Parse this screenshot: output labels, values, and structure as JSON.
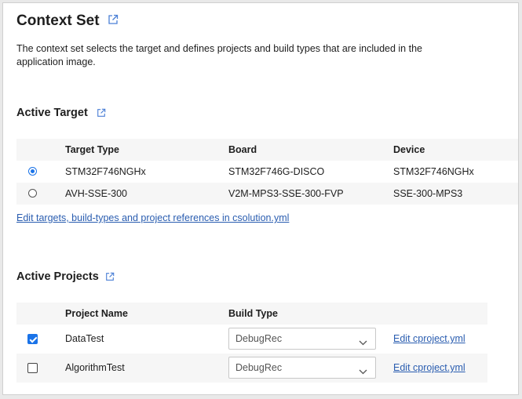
{
  "header": {
    "title": "Context Set",
    "description": "The context set selects the target and defines projects and build types that are included in the application image."
  },
  "active_target": {
    "title": "Active Target",
    "columns": [
      "Target Type",
      "Board",
      "Device"
    ],
    "rows": [
      {
        "selected": true,
        "target_type": "STM32F746NGHx",
        "board": "STM32F746G-DISCO",
        "device": "STM32F746NGHx"
      },
      {
        "selected": false,
        "target_type": "AVH-SSE-300",
        "board": "V2M-MPS3-SSE-300-FVP",
        "device": "SSE-300-MPS3"
      }
    ],
    "edit_link": "Edit targets, build-types and project references in csolution.yml"
  },
  "active_projects": {
    "title": "Active Projects",
    "columns": [
      "Project Name",
      "Build Type"
    ],
    "rows": [
      {
        "checked": true,
        "project_name": "DataTest",
        "build_type": "DebugRec",
        "edit_link": "Edit cproject.yml"
      },
      {
        "checked": false,
        "project_name": "AlgorithmTest",
        "build_type": "DebugRec",
        "edit_link": "Edit cproject.yml"
      }
    ]
  },
  "icons": {
    "external_link": "external-link-icon",
    "dropdown": "chevron-down-icon"
  },
  "colors": {
    "accent": "#1a73e8",
    "link": "#2a5db0",
    "row_stripe": "#f6f6f6"
  }
}
